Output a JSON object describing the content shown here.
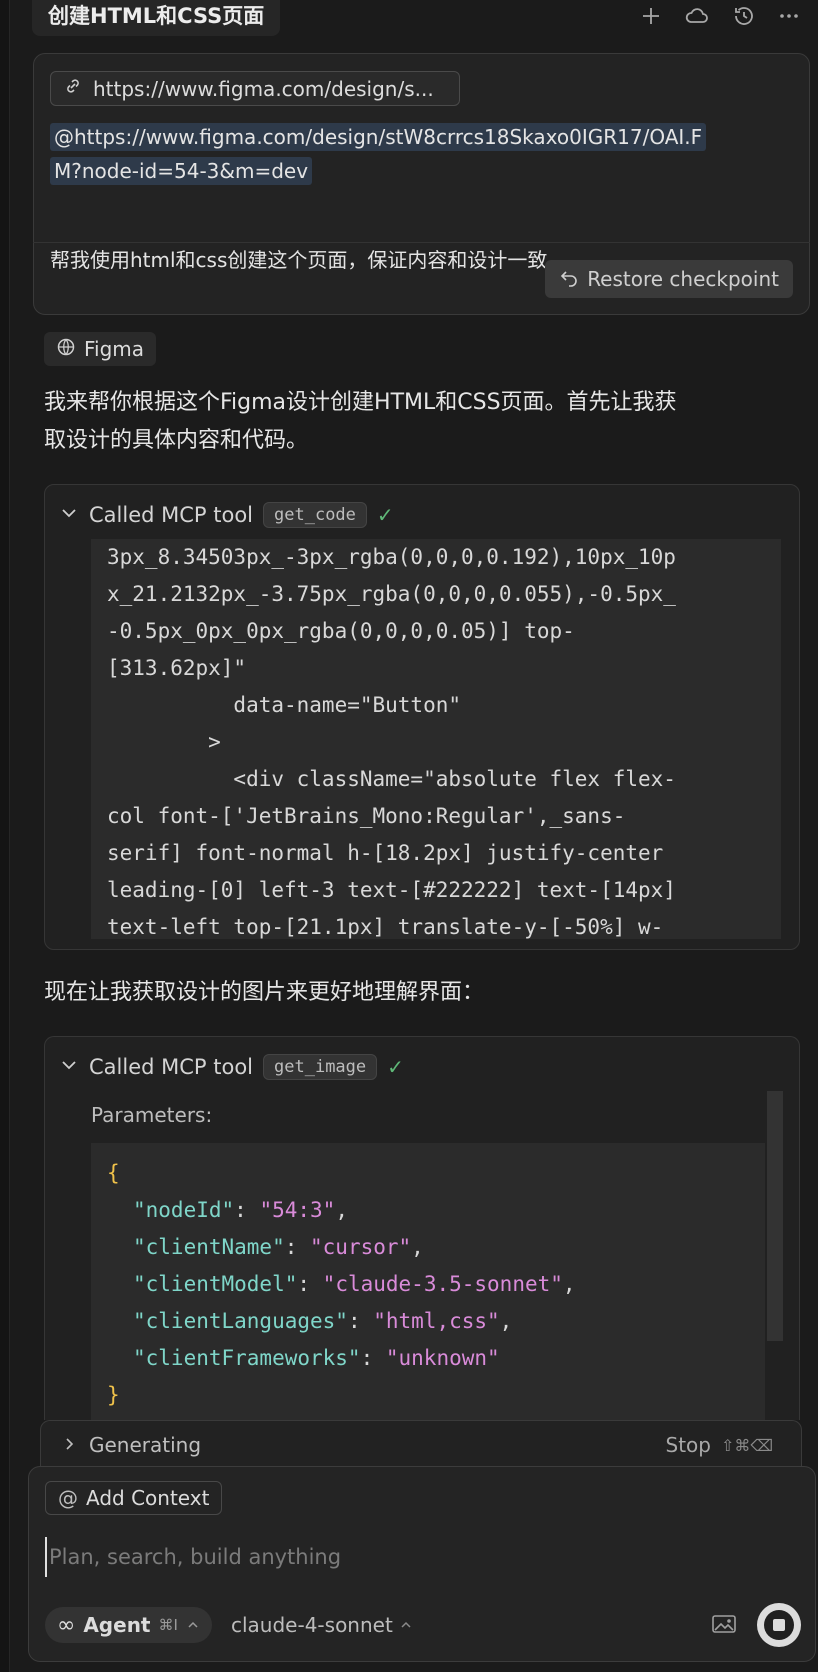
{
  "header": {
    "title": "创建HTML和CSS页面",
    "icons": [
      "plus-icon",
      "cloud-icon",
      "history-icon",
      "more-icon"
    ]
  },
  "user_message": {
    "url_chip": "https://www.figma.com/design/s...",
    "mention_line1": "@https://www.figma.com/design/stW8crrcs18Skaxo0IGR17/OAI.F",
    "mention_line2": "M?node-id=54-3&m=dev",
    "instruction": "帮我使用html和css创建这个页面，保证内容和设计一致",
    "restore_label": "Restore checkpoint"
  },
  "figma_chip": {
    "label": "Figma"
  },
  "assistant": {
    "intro_line1": "我来帮你根据这个Figma设计创建HTML和CSS页面。首先让我获",
    "intro_line2": "取设计的具体内容和代码。",
    "image_line": "现在让我获取设计的图片来更好地理解界面："
  },
  "tool1": {
    "label": "Called MCP tool",
    "tag": "get_code",
    "code_lines": [
      "3px_8.34503px_-3px_rgba(0,0,0,0.192),10px_10p",
      "x_21.2132px_-3.75px_rgba(0,0,0,0.055),-0.5px_",
      "-0.5px_0px_0px_rgba(0,0,0,0.05)] top-",
      "[313.62px]\"",
      "          data-name=\"Button\"",
      "        >",
      "          <div className=\"absolute flex flex-",
      "col font-['JetBrains_Mono:Regular',_sans-",
      "serif] font-normal h-[18.2px] justify-center",
      "leading-[0] left-3 text-[#222222] text-[14px]",
      "text-left top-[21.1px] translate-y-[-50%] w-"
    ]
  },
  "tool2": {
    "label": "Called MCP tool",
    "tag": "get_image",
    "params_label": "Parameters:",
    "json_open": "{",
    "json_close": "}",
    "params": [
      {
        "key": "\"nodeId\"",
        "value": "\"54:3\"",
        "comma": ","
      },
      {
        "key": "\"clientName\"",
        "value": "\"cursor\"",
        "comma": ","
      },
      {
        "key": "\"clientModel\"",
        "value": "\"claude-3.5-sonnet\"",
        "comma": ","
      },
      {
        "key": "\"clientLanguages\"",
        "value": "\"html,css\"",
        "comma": ","
      },
      {
        "key": "\"clientFrameworks\"",
        "value": "\"unknown\"",
        "comma": ""
      }
    ]
  },
  "generating": {
    "label": "Generating",
    "stop_label": "Stop",
    "stop_shortcut": "⇧⌘⌫"
  },
  "composer": {
    "add_context": "Add Context",
    "placeholder": "Plan, search, build anything",
    "agent_label": "Agent",
    "agent_shortcut": "⌘I",
    "model": "claude-4-sonnet"
  }
}
